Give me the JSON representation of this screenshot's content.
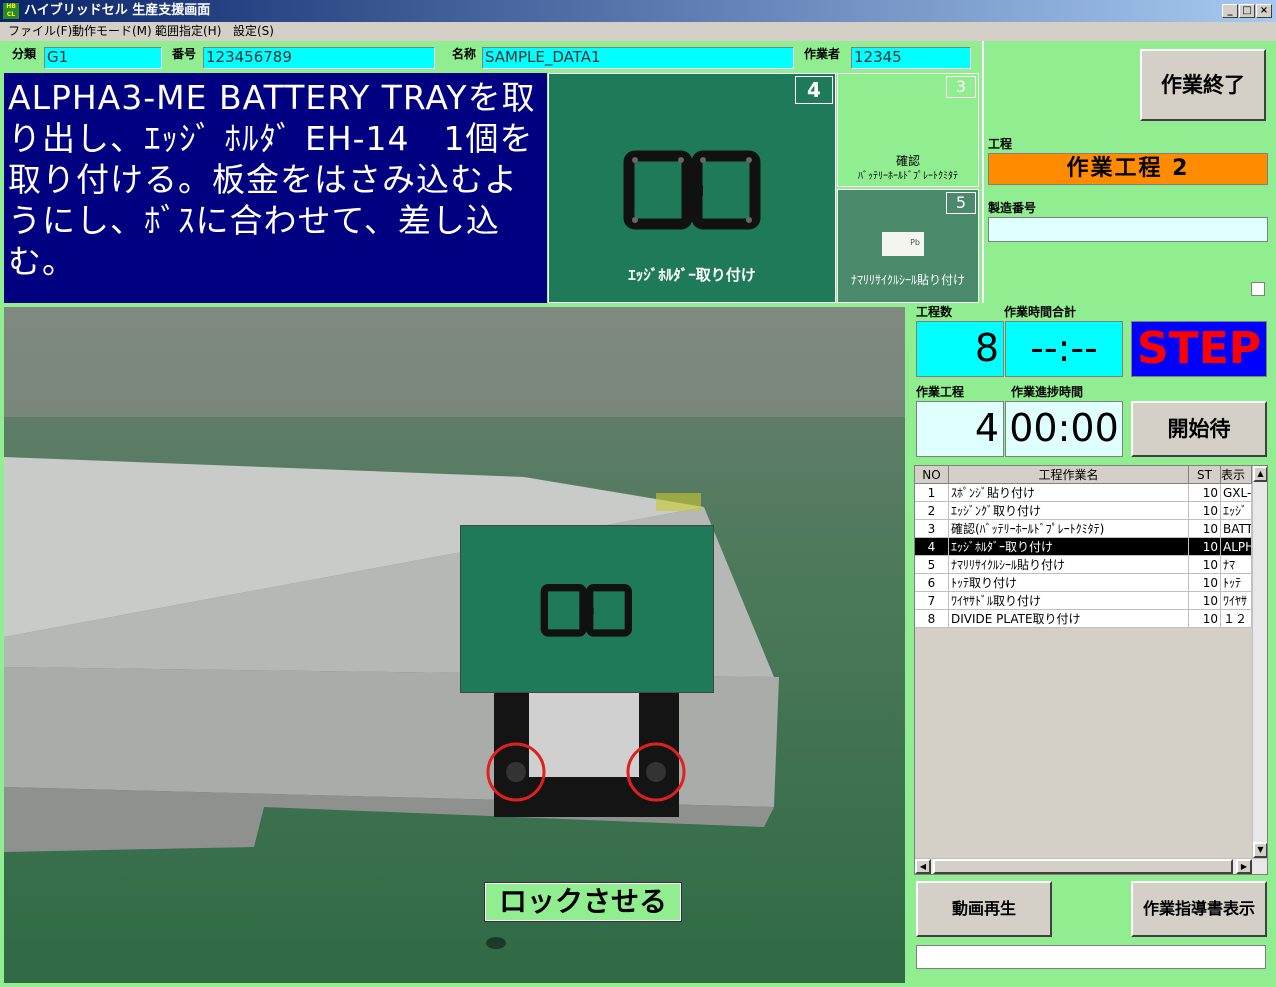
{
  "window": {
    "title": "ハイブリッドセル 生産支援画面",
    "icon_text": "HB\nCL",
    "min": "_",
    "max": "□",
    "close": "×"
  },
  "menu": [
    "ファイル(F)",
    "動作モード(M)",
    "範囲指定(H)",
    "設定(S)"
  ],
  "header": {
    "bunrui_label": "分類",
    "bunrui_value": "G1",
    "bango_label": "番号",
    "bango_value": "123456789",
    "meisho_label": "名称",
    "meisho_value": "SAMPLE_DATA1",
    "sagyosha_label": "作業者",
    "sagyosha_value": "12345"
  },
  "instruction": "ALPHA3-ME BATTERY TRAYを取り出し、ｴｯｼﾞ ﾎﾙﾀﾞ EH-14　1個を取り付ける。板金をはさみ込むようにし、ﾎﾞｽに合わせて、差し込む。",
  "thumbs": {
    "main": {
      "num": "4",
      "caption": "ｴｯｼﾞﾎﾙﾀﾞｰ取り付け"
    },
    "upper": {
      "num": "3",
      "caption1": "確認",
      "caption2": "ﾊﾞｯﾃﾘｰﾎｰﾙﾄﾞﾌﾟﾚｰﾄｸﾐﾀﾃ"
    },
    "lower": {
      "num": "5",
      "caption": "ﾅﾏﾘﾘｻｲｸﾙｼｰﾙ貼り付け",
      "label_text": "Pb"
    }
  },
  "photo": {
    "caption": "ロックさせる"
  },
  "right": {
    "end_button": "作業終了",
    "process_label": "工程",
    "process_value": "作業工程 2",
    "serial_label": "製造番号",
    "serial_value": "",
    "steps_label": "工程数",
    "steps_value": "8",
    "total_time_label": "作業時間合計",
    "total_time_value": "--:--",
    "step_label": "STEP",
    "current_label": "作業工程",
    "current_value": "4",
    "progress_label": "作業進捗時間",
    "progress_value": "00:00",
    "start_button": "開始待",
    "play_button": "動画再生",
    "manual_button": "作業指導書表示"
  },
  "table": {
    "headers": [
      "NO",
      "工程作業名",
      "ST",
      "表示"
    ],
    "rows": [
      {
        "no": "1",
        "name": "ｽﾎﾟﾝｼﾞ貼り付け",
        "st": "10",
        "disp": "GXL-"
      },
      {
        "no": "2",
        "name": "ｴｯｼﾞﾝｸﾞ取り付け",
        "st": "10",
        "disp": "ｴｯｼﾞ"
      },
      {
        "no": "3",
        "name": "確認(ﾊﾞｯﾃﾘｰﾎｰﾙﾄﾞﾌﾟﾚｰﾄｸﾐﾀﾃ)",
        "st": "10",
        "disp": "BATT"
      },
      {
        "no": "4",
        "name": "ｴｯｼﾞﾎﾙﾀﾞｰ取り付け",
        "st": "10",
        "disp": "ALPH"
      },
      {
        "no": "5",
        "name": "ﾅﾏﾘﾘｻｲｸﾙｼｰﾙ貼り付け",
        "st": "10",
        "disp": "ﾅﾏ"
      },
      {
        "no": "6",
        "name": "ﾄｯﾃ取り付け",
        "st": "10",
        "disp": "ﾄｯﾃ"
      },
      {
        "no": "7",
        "name": "ﾜｲﾔｻﾄﾞﾙ取り付け",
        "st": "10",
        "disp": "ﾜｲﾔｻ"
      },
      {
        "no": "8",
        "name": "DIVIDE PLATE取り付け",
        "st": "10",
        "disp": "１２"
      }
    ],
    "selected_index": 3
  },
  "colors": {
    "green_bg": "#90ee90",
    "navy": "#000080",
    "cyan": "#00ffff",
    "orange": "#ff8c00",
    "step_blue": "#0000ff",
    "step_red": "#ff0000"
  }
}
